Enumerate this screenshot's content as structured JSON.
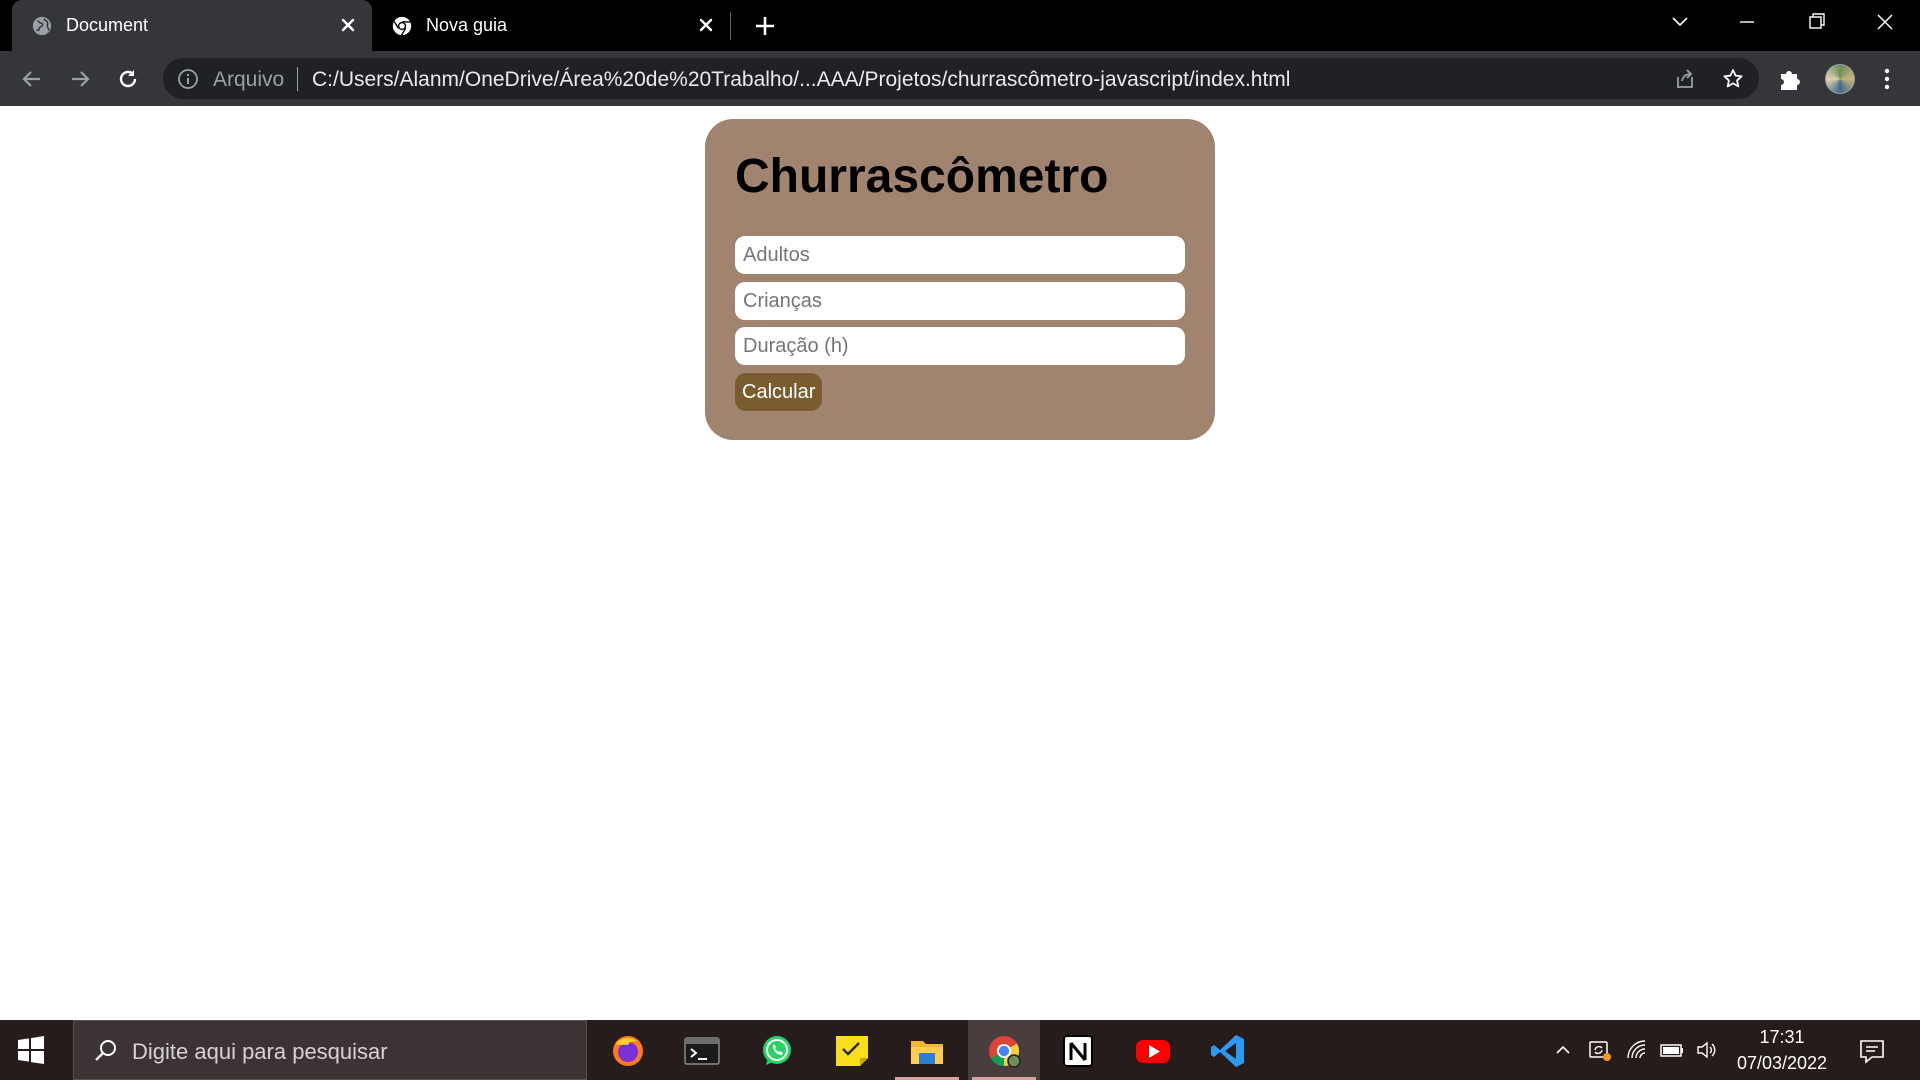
{
  "browser": {
    "tabs": [
      {
        "title": "Document",
        "active": true
      },
      {
        "title": "Nova guia",
        "active": false
      }
    ],
    "omnibox": {
      "scheme_label": "Arquivo",
      "url": "C:/Users/Alanm/OneDrive/Área%20de%20Trabalho/...AAA/Projetos/churrascômetro-javascript/index.html"
    }
  },
  "page": {
    "title": "Churrascômetro",
    "inputs": {
      "adults_placeholder": "Adultos",
      "children_placeholder": "Crianças",
      "duration_placeholder": "Duração (h)"
    },
    "calculate_label": "Calcular",
    "colors": {
      "card_background": "#a08470",
      "button_background": "#7a5c2e"
    }
  },
  "taskbar": {
    "search_placeholder": "Digite aqui para pesquisar",
    "apps": [
      "firefox-icon",
      "terminal-icon",
      "whatsapp-icon",
      "sticky-notes-icon",
      "file-explorer-icon",
      "chrome-icon",
      "notion-icon",
      "youtube-icon",
      "vscode-icon"
    ],
    "clock": {
      "time": "17:31",
      "date": "07/03/2022"
    }
  }
}
